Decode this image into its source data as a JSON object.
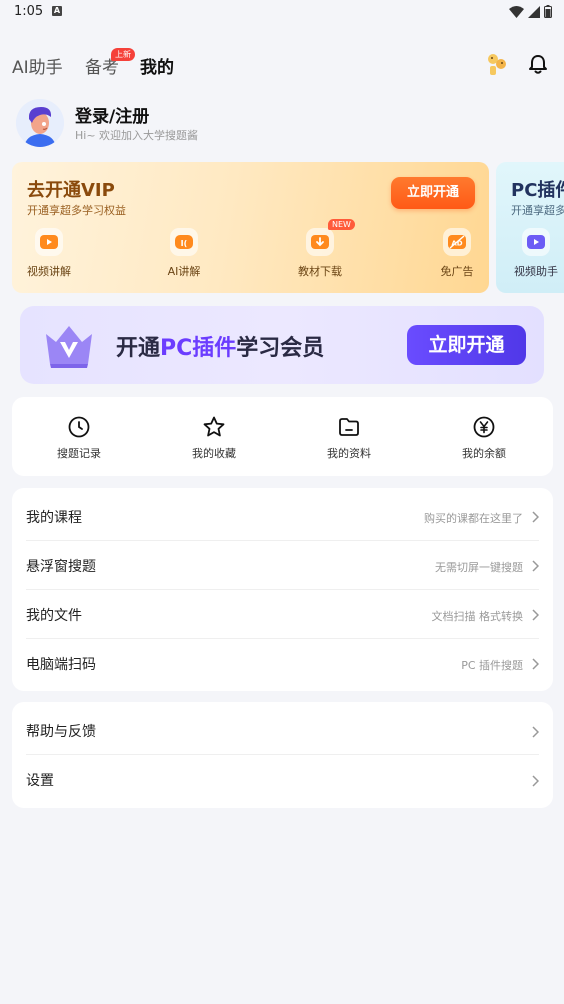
{
  "status_bar": {
    "time": "1:05",
    "a_icon_label": "A"
  },
  "header": {
    "tabs": [
      {
        "label": "AI助手",
        "active": false
      },
      {
        "label": "备考",
        "active": false,
        "badge": "上新"
      },
      {
        "label": "我的",
        "active": true
      }
    ],
    "mascot_icon": "mascot-icon",
    "bell_icon": "bell-icon"
  },
  "profile": {
    "title": "登录/注册",
    "subtitle": "Hi~ 欢迎加入大学搜题酱"
  },
  "vip_card": {
    "title": "去开通VIP",
    "subtitle": "开通享超多学习权益",
    "button": "立即开通",
    "perks": [
      {
        "label": "视频讲解",
        "icon": "video-play-icon"
      },
      {
        "label": "AI讲解",
        "icon": "ai-icon"
      },
      {
        "label": "教材下载",
        "icon": "download-icon",
        "badge": "NEW"
      },
      {
        "label": "免广告",
        "icon": "no-ad-icon"
      }
    ]
  },
  "pc_card": {
    "title": "PC插件",
    "subtitle": "开通享超多",
    "perk": {
      "label": "视频助手",
      "icon": "video-assistant-icon"
    }
  },
  "banner": {
    "text_prefix": "开通",
    "text_highlight": "PC插件",
    "text_suffix": "学习会员",
    "button": "立即开通"
  },
  "quick_actions": [
    {
      "label": "搜题记录",
      "icon": "clock-icon"
    },
    {
      "label": "我的收藏",
      "icon": "star-icon"
    },
    {
      "label": "我的资料",
      "icon": "folder-icon"
    },
    {
      "label": "我的余额",
      "icon": "yen-icon"
    }
  ],
  "menu_group_1": [
    {
      "label": "我的课程",
      "hint": "购买的课都在这里了"
    },
    {
      "label": "悬浮窗搜题",
      "hint": "无需切屏一键搜题"
    },
    {
      "label": "我的文件",
      "hint": "文档扫描 格式转换"
    },
    {
      "label": "电脑端扫码",
      "hint": "PC 插件搜题"
    }
  ],
  "menu_group_2": [
    {
      "label": "帮助与反馈",
      "hint": ""
    },
    {
      "label": "设置",
      "hint": ""
    }
  ],
  "colors": {
    "accent_orange": "#ff5a16",
    "accent_purple": "#6b3cff",
    "badge_red": "#f5413a"
  }
}
